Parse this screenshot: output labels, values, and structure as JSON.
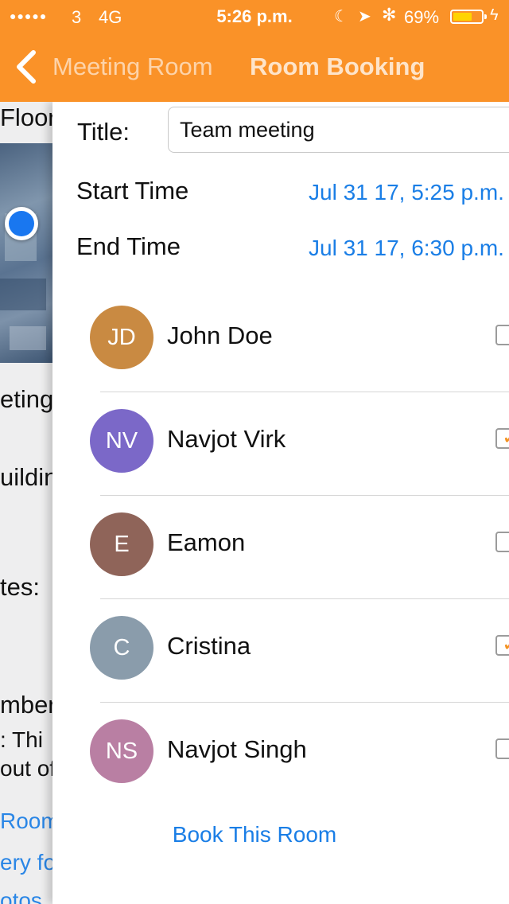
{
  "status_bar": {
    "signal": "●●●●●",
    "carrier": "3",
    "network": "4G",
    "time": "5:26 p.m.",
    "moon_glyph": "☾",
    "location_glyph": "➤",
    "bluetooth_glyph": "✻",
    "battery_percent_text": "69%",
    "battery_level": 0.69,
    "charging_glyph": "ϟ"
  },
  "nav": {
    "back_label": "Meeting Room",
    "title": "Room Booking"
  },
  "background_screen": {
    "texts": [
      "Floor",
      "eting",
      "uildin",
      "tes:",
      "mber",
      ": Thi",
      "out of",
      "Room",
      "ery fo",
      "otos"
    ]
  },
  "form": {
    "title_label": "Title:",
    "title_value": "Team meeting",
    "start_label": "Start Time",
    "start_value": "Jul 31 17, 5:25 p.m.",
    "end_label": "End Time",
    "end_value": "Jul 31 17, 6:30 p.m."
  },
  "attendees": [
    {
      "initials": "JD",
      "name": "John Doe",
      "checked": false,
      "color": "#c98a42"
    },
    {
      "initials": "NV",
      "name": "Navjot Virk",
      "checked": true,
      "color": "#7b68c8"
    },
    {
      "initials": "E",
      "name": "Eamon",
      "checked": false,
      "color": "#8f6459"
    },
    {
      "initials": "C",
      "name": "Cristina",
      "checked": true,
      "color": "#8a9cab"
    },
    {
      "initials": "NS",
      "name": "Navjot Singh",
      "checked": false,
      "color": "#b97fa3"
    }
  ],
  "book_button": "Book This Room",
  "colors": {
    "accent": "#fa9228",
    "link": "#1a7ee6",
    "check": "#f39322"
  }
}
